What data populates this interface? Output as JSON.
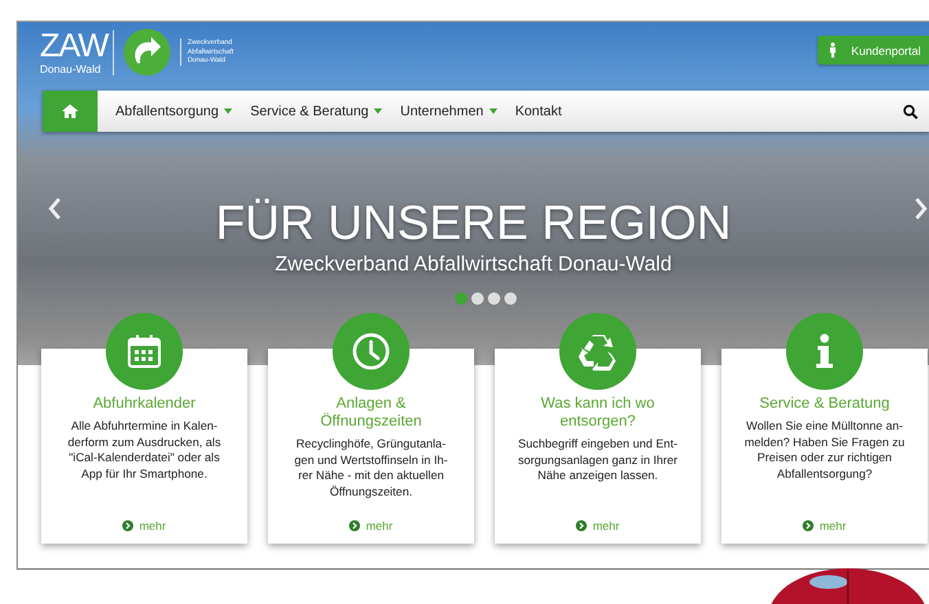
{
  "logo": {
    "wordmark": "ZAW",
    "subtitle": "Donau-Wald",
    "tagline_lines": [
      "Zweckverband",
      "Abfallwirtschaft",
      "Donau-Wald"
    ]
  },
  "portal_button": {
    "label": "Kundenportal"
  },
  "nav": {
    "items": [
      {
        "label": "Abfallentsorgung",
        "dropdown": true
      },
      {
        "label": "Service & Beratung",
        "dropdown": true
      },
      {
        "label": "Unternehmen",
        "dropdown": true
      },
      {
        "label": "Kontakt",
        "dropdown": false
      }
    ]
  },
  "hero": {
    "title": "FÜR UNSERE REGION",
    "subtitle": "Zweckverband Abfallwirtschaft Donau-Wald",
    "dots": [
      {
        "selected": true
      },
      {
        "selected": false
      },
      {
        "selected": false
      },
      {
        "selected": false
      }
    ]
  },
  "cards": [
    {
      "kind": "calendar",
      "title_lines": [
        "Abfuhrkalender"
      ],
      "text_lines": [
        "Alle Abfuhrtermine in Kalen-",
        "derform zum Ausdrucken, als",
        "\"iCal-Kalenderdatei\" oder als",
        "App für Ihr Smartphone."
      ],
      "link": "mehr"
    },
    {
      "kind": "clock",
      "title_lines": [
        "Anlagen &",
        "Öffnungszeiten"
      ],
      "text_lines": [
        "Recyclinghöfe, Grüngutanla-",
        "gen und Wertstoffinseln in Ih-",
        "rer Nähe - mit den aktuellen",
        "Öffnungszeiten."
      ],
      "link": "mehr"
    },
    {
      "kind": "recycle",
      "title_lines": [
        "Was kann ich wo",
        "entsorgen?"
      ],
      "text_lines": [
        "Suchbegriff eingeben und Ent-",
        "sorgungsanlagen ganz in Ihrer",
        "Nähe anzeigen lassen."
      ],
      "link": "mehr"
    },
    {
      "kind": "info",
      "title_lines": [
        "Service & Beratung"
      ],
      "text_lines": [
        "Wollen Sie eine Mülltonne an-",
        "melden? Haben Sie Fragen zu",
        "Preisen oder zur richtigen",
        "Abfallentsorgung?"
      ],
      "link": "mehr"
    }
  ]
}
